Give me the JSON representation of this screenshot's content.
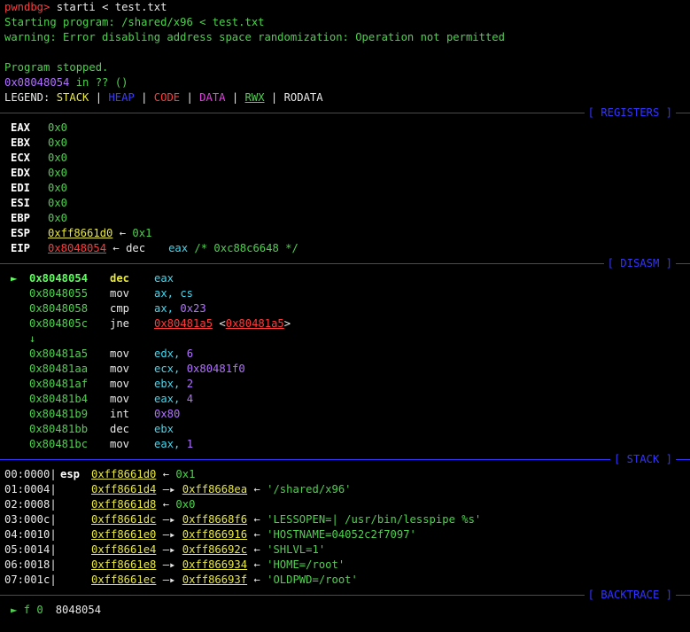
{
  "prompt": {
    "name": "pwndbg>",
    "command": " starti < test.txt"
  },
  "starting": "Starting program: /shared/x96 < test.txt",
  "warning": "warning: Error disabling address space randomization: Operation not permitted",
  "stopped": "Program stopped.",
  "location": {
    "addr": "0x08048054",
    "rest": " in ?? ()"
  },
  "legend": {
    "label": "LEGEND: ",
    "stack": "STACK",
    "heap": "HEAP",
    "code": "CODE",
    "data": "DATA",
    "rwx": "RWX",
    "rodata": "RODATA",
    "sep": " | "
  },
  "sections": {
    "registers": "[ REGISTERS ]",
    "disasm": "[ DISASM ]",
    "stack": "[ STACK ]",
    "backtrace": "[ BACKTRACE ]"
  },
  "registers": [
    {
      "name": "EAX",
      "value": "0x0"
    },
    {
      "name": "EBX",
      "value": "0x0"
    },
    {
      "name": "ECX",
      "value": "0x0"
    },
    {
      "name": "EDX",
      "value": "0x0"
    },
    {
      "name": "EDI",
      "value": "0x0"
    },
    {
      "name": "ESI",
      "value": "0x0"
    },
    {
      "name": "EBP",
      "value": "0x0"
    }
  ],
  "esp": {
    "name": "ESP",
    "value": "0xff8661d0",
    "arrow": " ← ",
    "deref": "0x1"
  },
  "eip": {
    "name": "EIP",
    "value": "0x8048054",
    "arrow": " ← ",
    "mnemonic": "dec",
    "operand": "eax",
    "comment": " /* 0xc88c6648 */"
  },
  "disasm": {
    "current_marker": "►",
    "rows_before": [
      {
        "addr": "0x8048054",
        "mnemonic": "dec",
        "operands": "eax"
      },
      {
        "addr": "0x8048055",
        "mnemonic": "mov",
        "operands": "ax, cs"
      },
      {
        "addr": "0x8048058",
        "mnemonic": "cmp",
        "operands": "ax, ",
        "imm": "0x23"
      },
      {
        "addr": "0x804805c",
        "mnemonic": "jne",
        "target": "0x80481a5",
        "target2": "0x80481a5"
      }
    ],
    "jump_arrow": "↓",
    "rows_after": [
      {
        "addr": "0x80481a5",
        "mnemonic": "mov",
        "operands": "edx, ",
        "imm": "6"
      },
      {
        "addr": "0x80481aa",
        "mnemonic": "mov",
        "operands": "ecx, ",
        "imm": "0x80481f0"
      },
      {
        "addr": "0x80481af",
        "mnemonic": "mov",
        "operands": "ebx, ",
        "imm": "2"
      },
      {
        "addr": "0x80481b4",
        "mnemonic": "mov",
        "operands": "eax, ",
        "imm": "4"
      },
      {
        "addr": "0x80481b9",
        "mnemonic": "int",
        "operands": "",
        "imm": "0x80"
      },
      {
        "addr": "0x80481bb",
        "mnemonic": "dec",
        "operands": "ebx",
        "imm": ""
      },
      {
        "addr": "0x80481bc",
        "mnemonic": "mov",
        "operands": "eax, ",
        "imm": "1"
      }
    ]
  },
  "stack": [
    {
      "idx": "00:0000|",
      "reg": "esp",
      "addr": "0xff8661d0",
      "arrow": " ← ",
      "ptr": "",
      "val": "0x1"
    },
    {
      "idx": "01:0004|",
      "reg": "",
      "addr": "0xff8661d4",
      "arrow": " —▸ ",
      "ptr": "0xff8668ea",
      "val": "'/shared/x96'"
    },
    {
      "idx": "02:0008|",
      "reg": "",
      "addr": "0xff8661d8",
      "arrow": " ← ",
      "ptr": "",
      "val": "0x0"
    },
    {
      "idx": "03:000c|",
      "reg": "",
      "addr": "0xff8661dc",
      "arrow": " —▸ ",
      "ptr": "0xff8668f6",
      "val": "'LESSOPEN=| /usr/bin/lesspipe %s'"
    },
    {
      "idx": "04:0010|",
      "reg": "",
      "addr": "0xff8661e0",
      "arrow": " —▸ ",
      "ptr": "0xff866916",
      "val": "'HOSTNAME=04052c2f7097'"
    },
    {
      "idx": "05:0014|",
      "reg": "",
      "addr": "0xff8661e4",
      "arrow": " —▸ ",
      "ptr": "0xff86692c",
      "val": "'SHLVL=1'"
    },
    {
      "idx": "06:0018|",
      "reg": "",
      "addr": "0xff8661e8",
      "arrow": " —▸ ",
      "ptr": "0xff866934",
      "val": "'HOME=/root'"
    },
    {
      "idx": "07:001c|",
      "reg": "",
      "addr": "0xff8661ec",
      "arrow": " —▸ ",
      "ptr": "0xff86693f",
      "val": "'OLDPWD=/root'"
    }
  ],
  "backtrace": {
    "marker": "►",
    "frame": " f 0",
    "addr": "8048054"
  }
}
